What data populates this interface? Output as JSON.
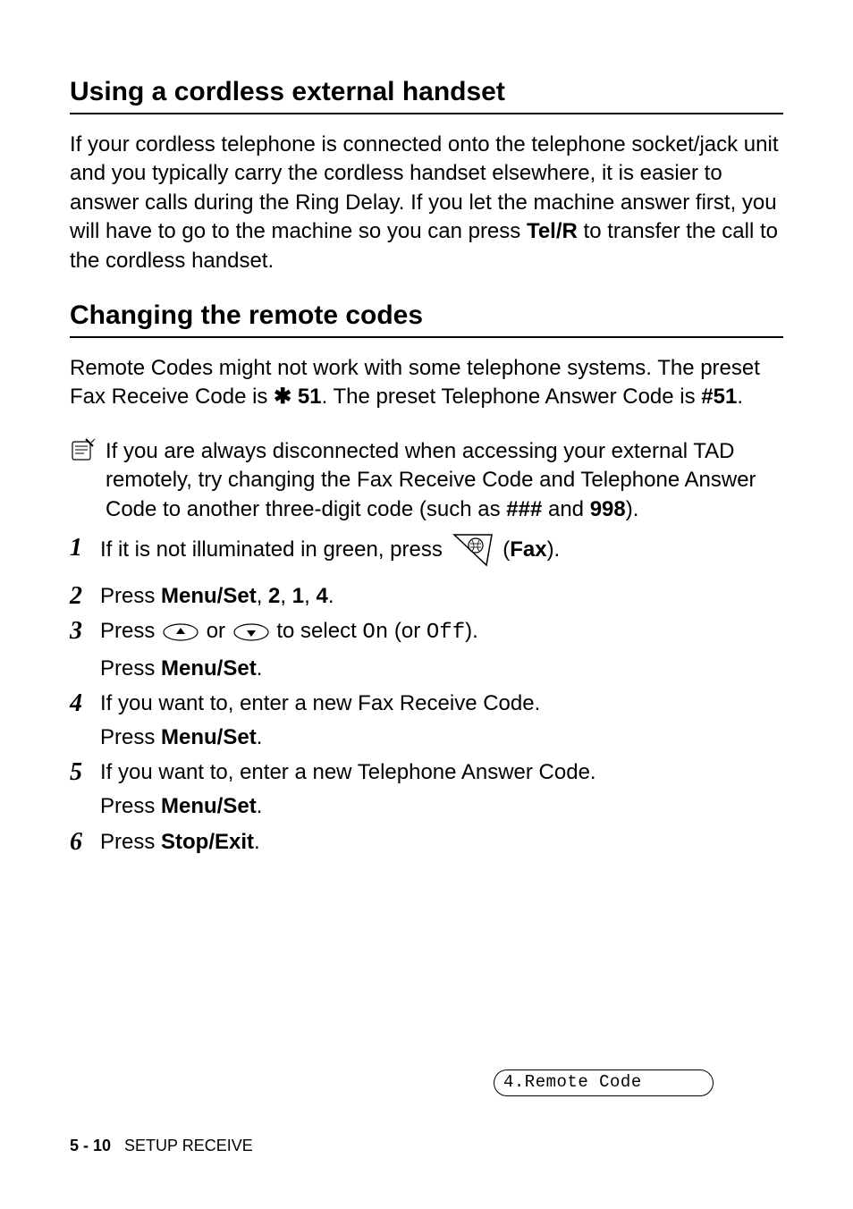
{
  "section1": {
    "heading": "Using a cordless external handset",
    "para_a": "If your cordless telephone is connected onto the telephone socket/jack unit and you typically carry the cordless handset elsewhere, it is easier to answer calls during the Ring Delay. If you let the machine answer first, you will have to go to the machine so you can press ",
    "para_key": "Tel/R",
    "para_b": " to transfer the call to the cordless handset."
  },
  "section2": {
    "heading": "Changing the remote codes",
    "intro_a": "Remote Codes might not work with some telephone systems. The preset Fax Receive Code is ",
    "intro_code1": " 51",
    "intro_b": ". The preset Telephone Answer Code is ",
    "intro_code2": "#51",
    "intro_c": ".",
    "note_a": "If you are always disconnected when accessing your external TAD remotely, try changing the Fax Receive Code and Telephone Answer Code to another three-digit code (such as ",
    "note_code1": "###",
    "note_mid": " and ",
    "note_code2": "998",
    "note_b": ")."
  },
  "lcd": "4.Remote Code",
  "steps": {
    "s1_a": "If it is not illuminated in green, press ",
    "s1_b": " (",
    "s1_key": "Fax",
    "s1_c": ").",
    "s2_a": "Press ",
    "s2_k1": "Menu/Set",
    "s2_sep": ", ",
    "s2_k2": "2",
    "s2_k3": "1",
    "s2_k4": "4",
    "s2_end": ".",
    "s3_a": "Press ",
    "s3_b": " or ",
    "s3_c": " to select ",
    "s3_on": "On",
    "s3_d": " (or ",
    "s3_off": "Off",
    "s3_e": ").",
    "s3_sub_a": "Press ",
    "s3_sub_k": "Menu/Set",
    "s3_sub_b": ".",
    "s4_a": "If you want to, enter a new Fax Receive Code.",
    "s4_sub_a": "Press ",
    "s4_sub_k": "Menu/Set",
    "s4_sub_b": ".",
    "s5_a": "If you want to, enter a new Telephone Answer Code.",
    "s5_sub_a": "Press ",
    "s5_sub_k": "Menu/Set",
    "s5_sub_b": ".",
    "s6_a": "Press ",
    "s6_k": "Stop/Exit",
    "s6_b": "."
  },
  "footer": {
    "page": "5 - 10",
    "title": "SETUP RECEIVE"
  }
}
